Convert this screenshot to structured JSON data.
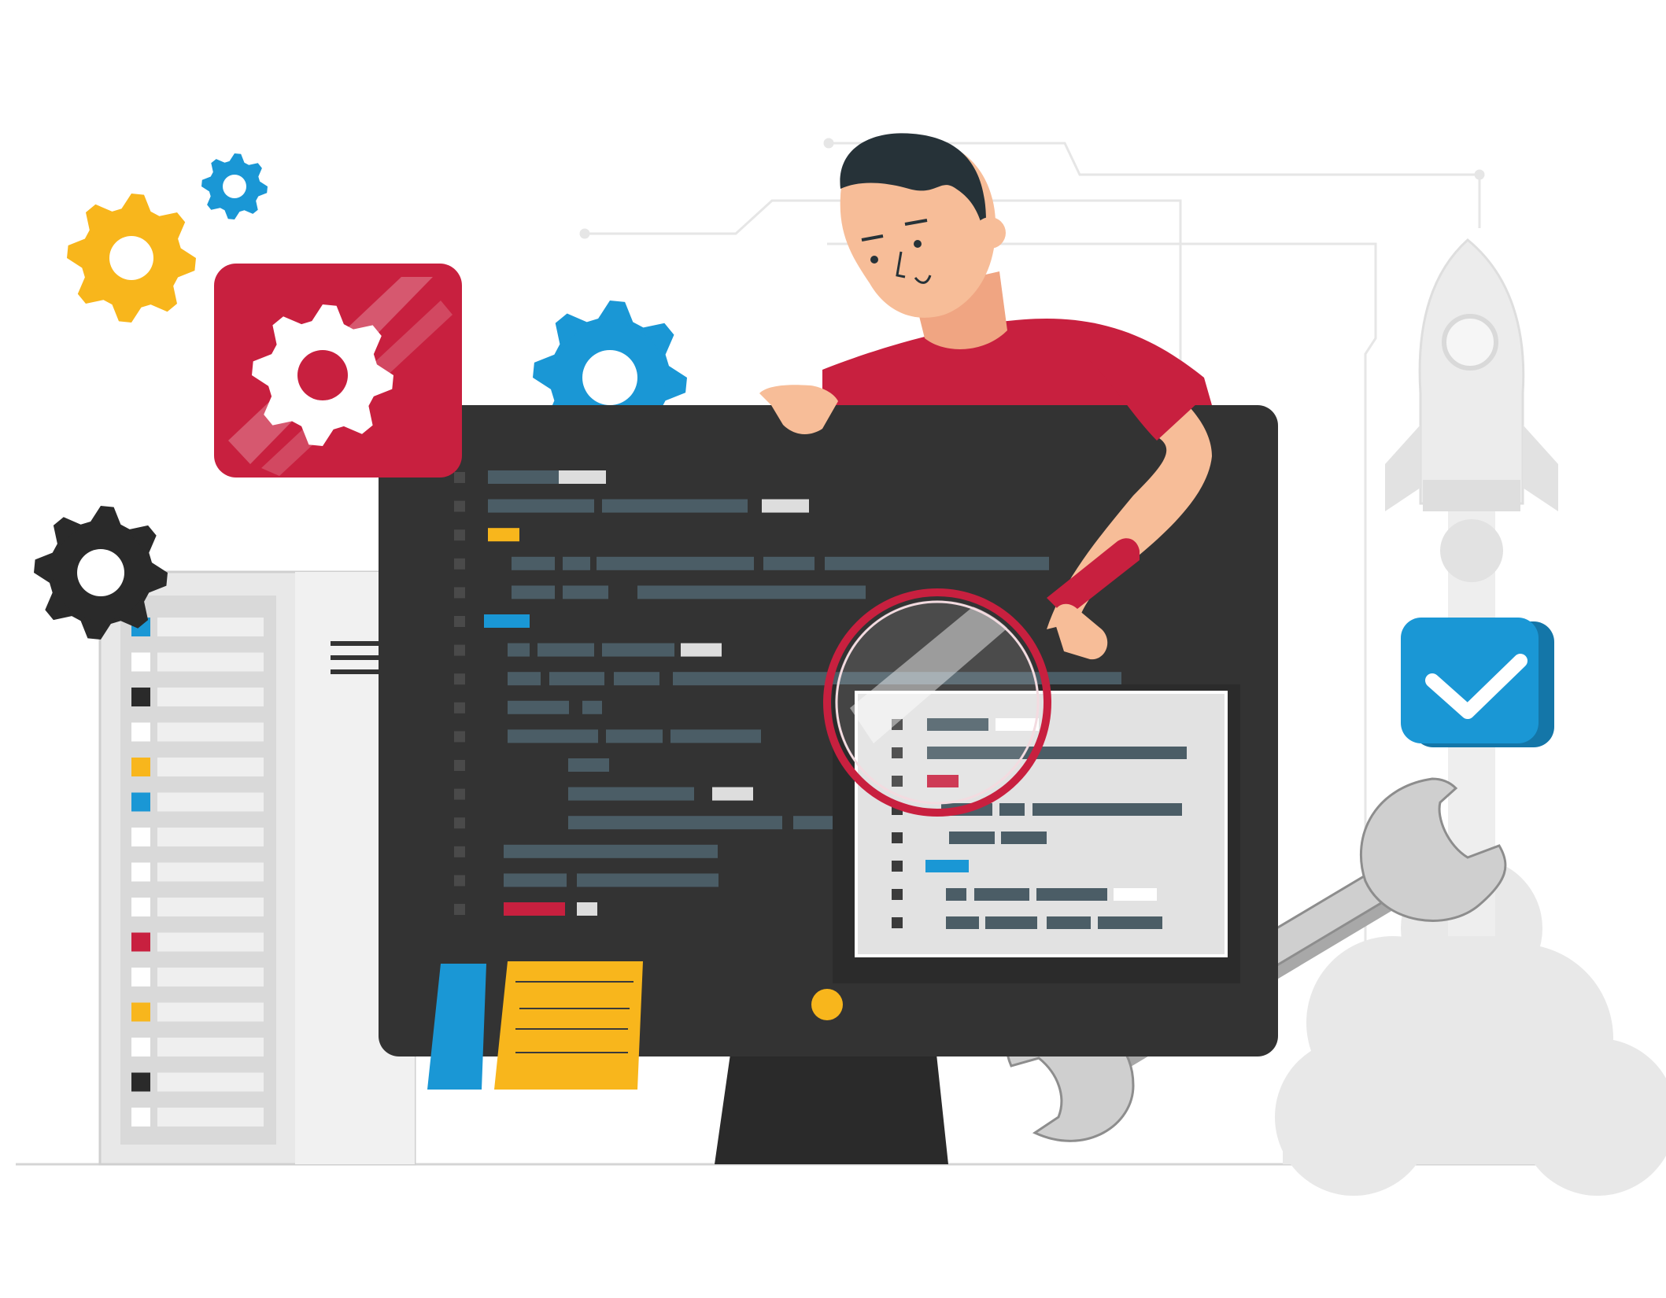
{
  "scene": {
    "subject": "developer-with-magnifier-inspecting-code",
    "colors": {
      "accent_red": "#C8203F",
      "accent_blue": "#1A97D5",
      "accent_yellow": "#F8B61C",
      "monitor_dark": "#333333",
      "code_line": "#4B5D66",
      "panel_gray": "#E2E2E2",
      "skin": "#F7BD98",
      "hair": "#263238"
    },
    "icons": [
      "gear-icon",
      "settings-app-icon",
      "magnifying-glass-icon",
      "checkmark-icon",
      "wrench-icon",
      "rocket-icon",
      "sticky-note-icon",
      "server-rack-icon"
    ]
  }
}
